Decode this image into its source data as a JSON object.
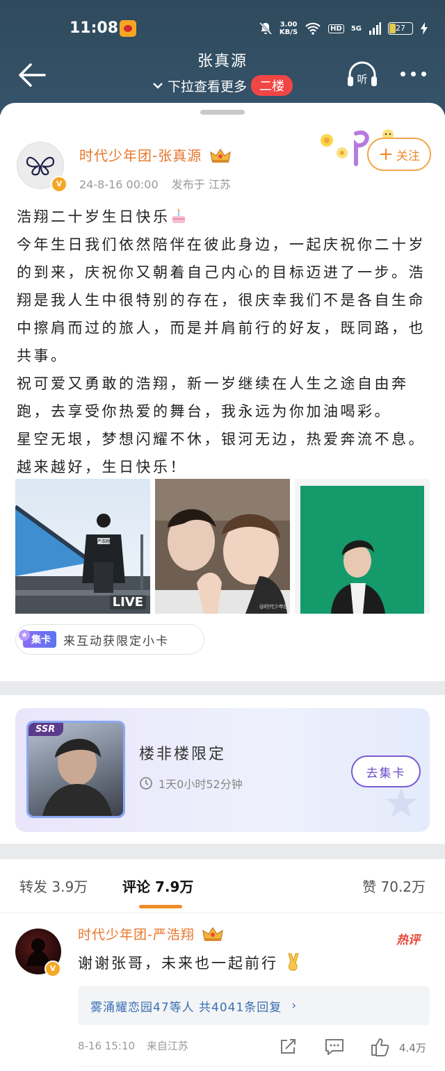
{
  "status": {
    "time": "11:08",
    "speed_value": "3.00",
    "speed_unit": "KB/S",
    "network": "5G",
    "hd": "HD",
    "battery": "27"
  },
  "header": {
    "title": "张真源",
    "subtitle": "下拉查看更多",
    "floor_badge": "二楼"
  },
  "post": {
    "author": "时代少年团-张真源",
    "date": "24-8-16 00:00",
    "location": "发布于 江苏",
    "follow_label": "关注",
    "paragraphs": [
      "浩翔二十岁生日快乐",
      "今年生日我们依然陪伴在彼此身边，一起庆祝你二十岁的到来，庆祝你又朝着自己内心的目标迈进了一步。浩翔是我人生中很特别的存在，很庆幸我们不是各自生命中擦肩而过的旅人，而是并肩前行的好友，既同路，也共事。",
      "祝可爱又勇敢的浩翔，新一岁继续在人生之途自由奔跑，去享受你热爱的舞台，我永远为你加油喝彩。",
      "星空无垠，梦想闪耀不休，银河无边，热爱奔流不息。越来越好，生日快乐！"
    ],
    "live_label": "LIVE",
    "photo2_watermark": "@时代少年团",
    "jika_badge": "集卡",
    "jika_text": "来互动获限定小卡"
  },
  "banner": {
    "ssr_label": "SSR",
    "title": "楼非楼限定",
    "time_left": "1天0小时52分钟",
    "button_label": "去集卡"
  },
  "tabs": [
    {
      "label": "转发",
      "count": "3.9万"
    },
    {
      "label": "评论",
      "count": "7.9万"
    },
    {
      "label": "赞",
      "count": "70.2万"
    }
  ],
  "comment": {
    "author": "时代少年团-严浩翔",
    "hot_label": "热评",
    "text": "谢谢张哥，未来也一起前行",
    "reply_summary": "雾涌耀恋园47等人 共4041条回复",
    "reply_arrow": "›",
    "date": "8-16 15:10",
    "location": "来自江苏",
    "likes": "4.4万"
  },
  "colors": {
    "header_bg": "#35536a",
    "accent_orange": "#e8752a",
    "floor_badge_bg": "#f04646",
    "tab_underline": "#f08a24",
    "link_blue": "#3a6fb3"
  },
  "icons": [
    "back-arrow-icon",
    "headphones-listen-icon",
    "more-dots-icon",
    "vip-crown-icon",
    "verified-v-icon",
    "clock-icon",
    "share-icon",
    "comment-icon",
    "like-icon"
  ]
}
